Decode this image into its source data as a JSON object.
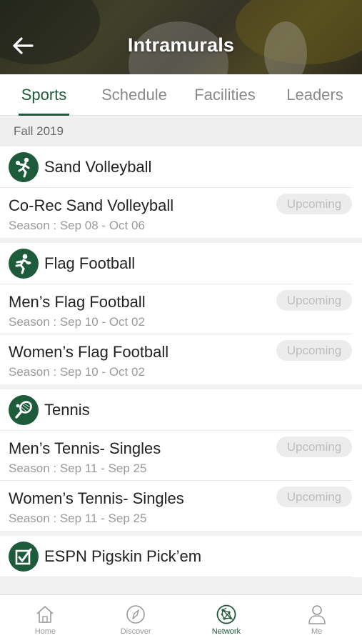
{
  "header": {
    "title": "Intramurals",
    "back_icon": "arrow-left-icon"
  },
  "tabs": [
    {
      "label": "Sports",
      "active": true
    },
    {
      "label": "Schedule",
      "active": false
    },
    {
      "label": "Facilities",
      "active": false
    },
    {
      "label": "Leaders",
      "active": false
    }
  ],
  "term": "Fall 2019",
  "sports": [
    {
      "name": "Sand Volleyball",
      "icon": "volleyball-player-icon",
      "leagues": [
        {
          "name": "Co-Rec Sand Volleyball",
          "season": "Season : Sep 08 - Oct 06",
          "status": "Upcoming"
        }
      ]
    },
    {
      "name": "Flag Football",
      "icon": "football-player-icon",
      "leagues": [
        {
          "name": "Men’s Flag Football",
          "season": "Season : Sep 10 - Oct 02",
          "status": "Upcoming"
        },
        {
          "name": "Women’s Flag Football",
          "season": "Season : Sep 10 - Oct 02",
          "status": "Upcoming"
        }
      ]
    },
    {
      "name": "Tennis",
      "icon": "tennis-racket-icon",
      "leagues": [
        {
          "name": "Men’s Tennis- Singles",
          "season": "Season : Sep 11 - Sep 25",
          "status": "Upcoming"
        },
        {
          "name": "Women’s Tennis- Singles",
          "season": "Season : Sep 11 - Sep 25",
          "status": "Upcoming"
        }
      ]
    },
    {
      "name": "ESPN Pigskin Pick’em",
      "icon": "checkbox-icon",
      "leagues": []
    }
  ],
  "bottom_nav": [
    {
      "label": "Home",
      "icon": "home-icon",
      "active": false
    },
    {
      "label": "Discover",
      "icon": "compass-icon",
      "active": false
    },
    {
      "label": "Network",
      "icon": "network-icon",
      "active": true
    },
    {
      "label": "Me",
      "icon": "person-icon",
      "active": false
    }
  ],
  "colors": {
    "accent": "#1e5b3a",
    "badge_bg": "#ececec",
    "badge_text": "#bdbdbd"
  }
}
